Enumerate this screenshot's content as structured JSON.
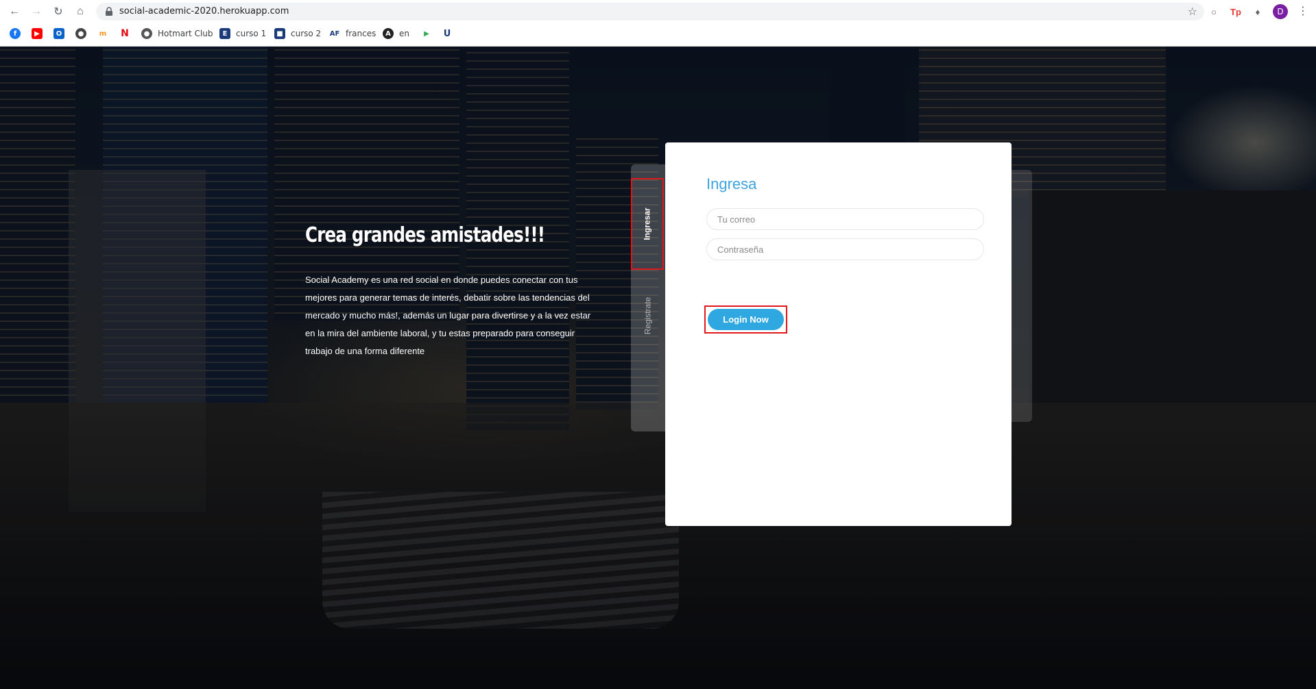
{
  "browser": {
    "url": "social-academic-2020.herokuapp.com",
    "profile_initial": "D",
    "bookmarks": [
      {
        "label": "",
        "icon": "facebook-icon",
        "color": "#1877f2"
      },
      {
        "label": "",
        "icon": "youtube-icon",
        "color": "#ff0000"
      },
      {
        "label": "",
        "icon": "outlook-icon",
        "color": "#0a64c8"
      },
      {
        "label": "",
        "icon": "globe-icon",
        "color": "#444444"
      },
      {
        "label": "",
        "icon": "mn-icon",
        "color": "#f7931e"
      },
      {
        "label": "",
        "icon": "netflix-icon",
        "color": "#e50914"
      },
      {
        "label": "Hotmart Club",
        "icon": "hotmart-icon",
        "color": "#555555"
      },
      {
        "label": "curso 1",
        "icon": "curso1-icon",
        "color": "#1a3a7a"
      },
      {
        "label": "curso 2",
        "icon": "curso2-icon",
        "color": "#1a3a7a"
      },
      {
        "label": "frances",
        "icon": "af-icon",
        "color": "#1a3a7a"
      },
      {
        "label": "en",
        "icon": "a-icon",
        "color": "#222222"
      },
      {
        "label": "",
        "icon": "play-icon",
        "color": "#34a853"
      },
      {
        "label": "",
        "icon": "u-icon",
        "color": "#1a3a7a"
      }
    ]
  },
  "hero": {
    "title": "Crea grandes amistades!!!",
    "text": "Social Academy es una red social en donde puedes conectar con tus mejores para generar temas de interés, debatir sobre las tendencias del mercado y mucho más!, además un lugar para divertirse y a la vez estar en la mira del ambiente laboral, y tu estas preparado para conseguir trabajo de una forma diferente"
  },
  "tabs": {
    "ingresar": "Ingresar",
    "registrate": "Registrate"
  },
  "login": {
    "title": "Ingresa",
    "email_placeholder": "Tu correo",
    "password_placeholder": "Contraseña",
    "button": "Login Now"
  },
  "colors": {
    "accent": "#3ea4df",
    "button": "#2fa8e2",
    "highlight": "#e0181b"
  }
}
